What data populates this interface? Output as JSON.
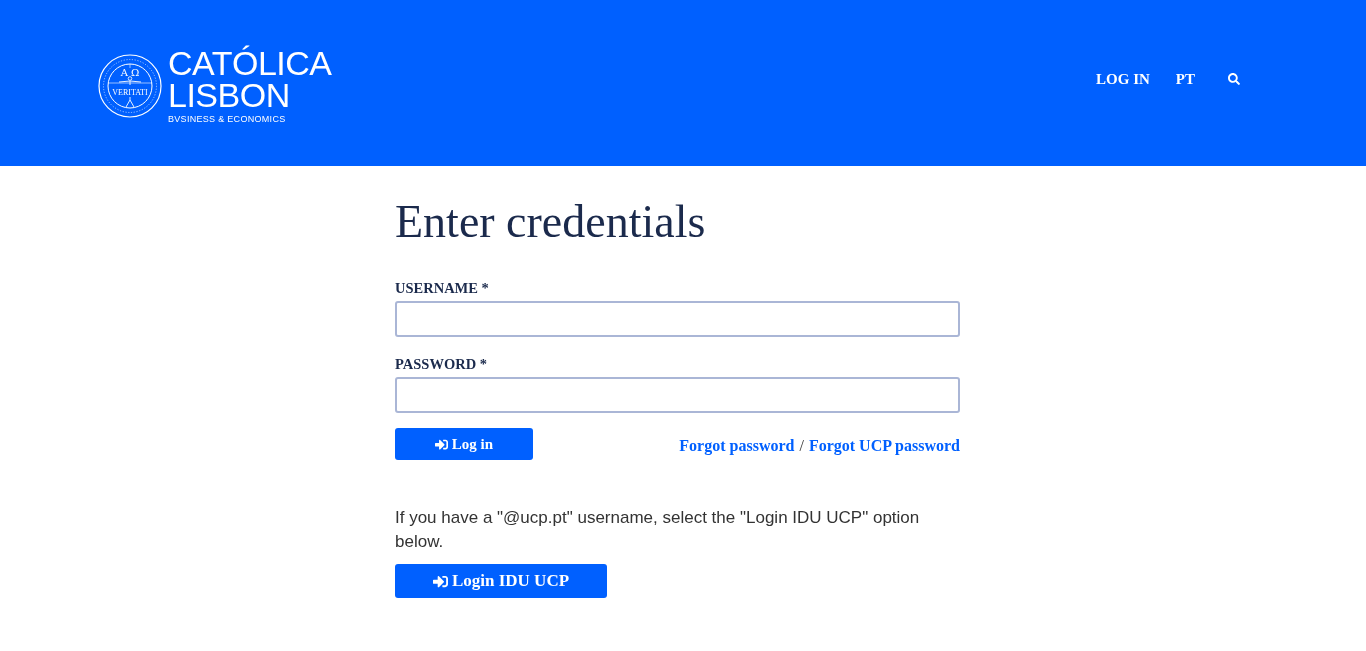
{
  "header": {
    "logo": {
      "seal": {
        "letters": "A Ω",
        "motto": "VERITATI"
      },
      "name_lines": [
        "CATÓLICA",
        "LISBON"
      ],
      "tagline": "BVSINESS & ECONOMICS"
    },
    "nav": [
      {
        "kind": "link",
        "label": "LOG IN"
      },
      {
        "kind": "link",
        "label": "PT"
      },
      {
        "kind": "search"
      }
    ]
  },
  "form": {
    "title": "Enter credentials",
    "fields": [
      {
        "label": "USERNAME *"
      },
      {
        "label": "PASSWORD *"
      }
    ],
    "submit": "Log in",
    "links": [
      "Forgot password",
      "Forgot UCP password"
    ],
    "separator": "/",
    "note": "If you have a \"@ucp.pt\" username, select the \"Login IDU UCP\" option below.",
    "alt_button": "Login IDU UCP"
  }
}
